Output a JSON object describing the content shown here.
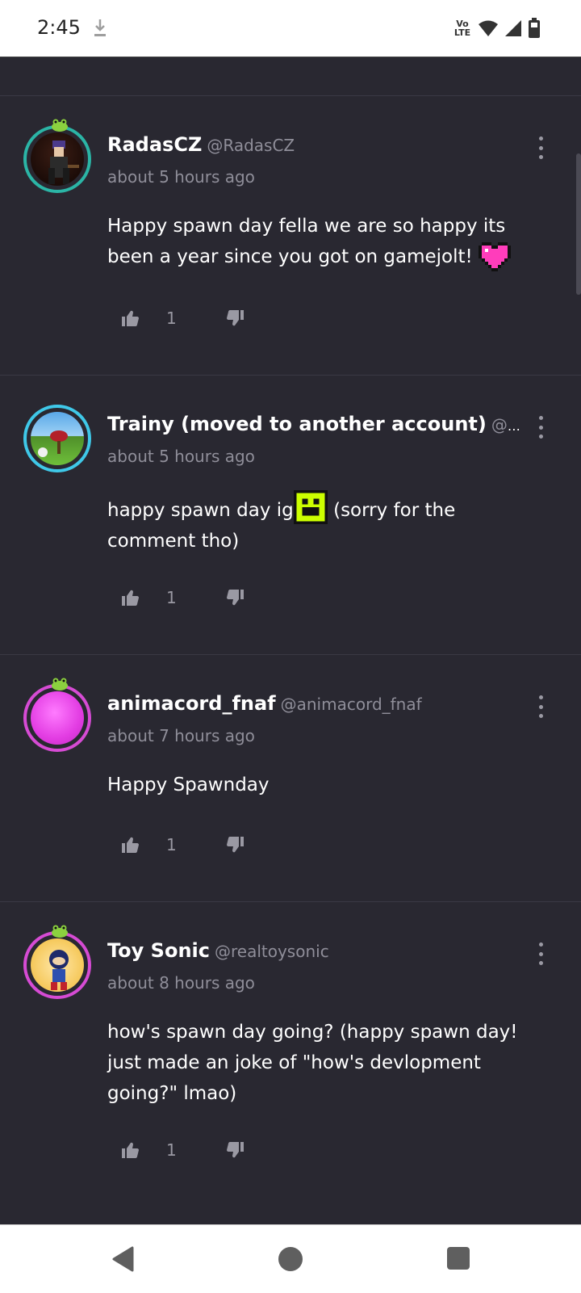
{
  "status_bar": {
    "time": "2:45",
    "volte_line1": "Vo",
    "volte_line2": "LTE",
    "icons": [
      "download-icon",
      "volte-icon",
      "wifi-icon",
      "signal-icon",
      "battery-icon"
    ]
  },
  "comments": [
    {
      "display_name": "RadasCZ",
      "username": "@RadasCZ",
      "time": "about 5 hours ago",
      "text": "Happy spawn day fella we are so happy its been a year since you got on gamejolt!",
      "sticker": "pink-heart-sticker",
      "likes": "1",
      "avatar_ring_color": "#2bb5a6"
    },
    {
      "display_name": "Trainy (moved to another account)",
      "username": "@are...",
      "time": "about 5 hours ago",
      "text_before": "happy spawn day ig",
      "text_after": " (sorry for the comment tho)",
      "sticker": "green-face-sticker",
      "likes": "1",
      "avatar_ring_color": "#3fc8e8"
    },
    {
      "display_name": "animacord_fnaf",
      "username": "@animacord_fnaf",
      "time": "about 7 hours ago",
      "text": "Happy Spawnday",
      "likes": "1",
      "avatar_ring_color": "#d64bd4"
    },
    {
      "display_name": "Toy Sonic",
      "username": "@realtoysonic",
      "time": "about 8 hours ago",
      "text": "how's spawn day going? (happy spawn day! just made an joke of \"how's devlopment going?\" lmao)",
      "likes": "1",
      "avatar_ring_color": "#d64bd4"
    }
  ],
  "colors": {
    "background": "#292831",
    "muted_text": "#8f8e99",
    "heart_pink": "#ff3dbb",
    "sticker_green": "#ccff00"
  }
}
